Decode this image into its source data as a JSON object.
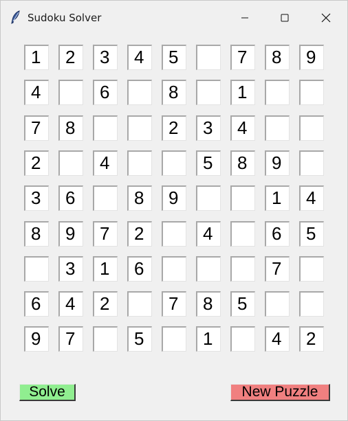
{
  "window": {
    "title": "Sudoku Solver",
    "icon": "feather-icon",
    "controls": [
      "minimize-icon",
      "maximize-icon",
      "close-icon"
    ]
  },
  "grid": [
    [
      "1",
      "2",
      "3",
      "4",
      "5",
      "",
      "7",
      "8",
      "9"
    ],
    [
      "4",
      "",
      "6",
      "",
      "8",
      "",
      "1",
      "",
      ""
    ],
    [
      "7",
      "8",
      "",
      "",
      "2",
      "3",
      "4",
      "",
      ""
    ],
    [
      "2",
      "",
      "4",
      "",
      "",
      "5",
      "8",
      "9",
      ""
    ],
    [
      "3",
      "6",
      "",
      "8",
      "9",
      "",
      "",
      "1",
      "4"
    ],
    [
      "8",
      "9",
      "7",
      "2",
      "",
      "4",
      "",
      "6",
      "5"
    ],
    [
      "",
      "3",
      "1",
      "6",
      "",
      "",
      "",
      "7",
      ""
    ],
    [
      "6",
      "4",
      "2",
      "",
      "7",
      "8",
      "5",
      "",
      ""
    ],
    [
      "9",
      "7",
      "",
      "5",
      "",
      "1",
      "",
      "4",
      "2"
    ]
  ],
  "buttons": {
    "solve_label": "Solve",
    "new_puzzle_label": "New Puzzle"
  },
  "colors": {
    "solve_button": "#90ee90",
    "new_puzzle_button": "#f08080",
    "background": "#f0f0f0"
  }
}
